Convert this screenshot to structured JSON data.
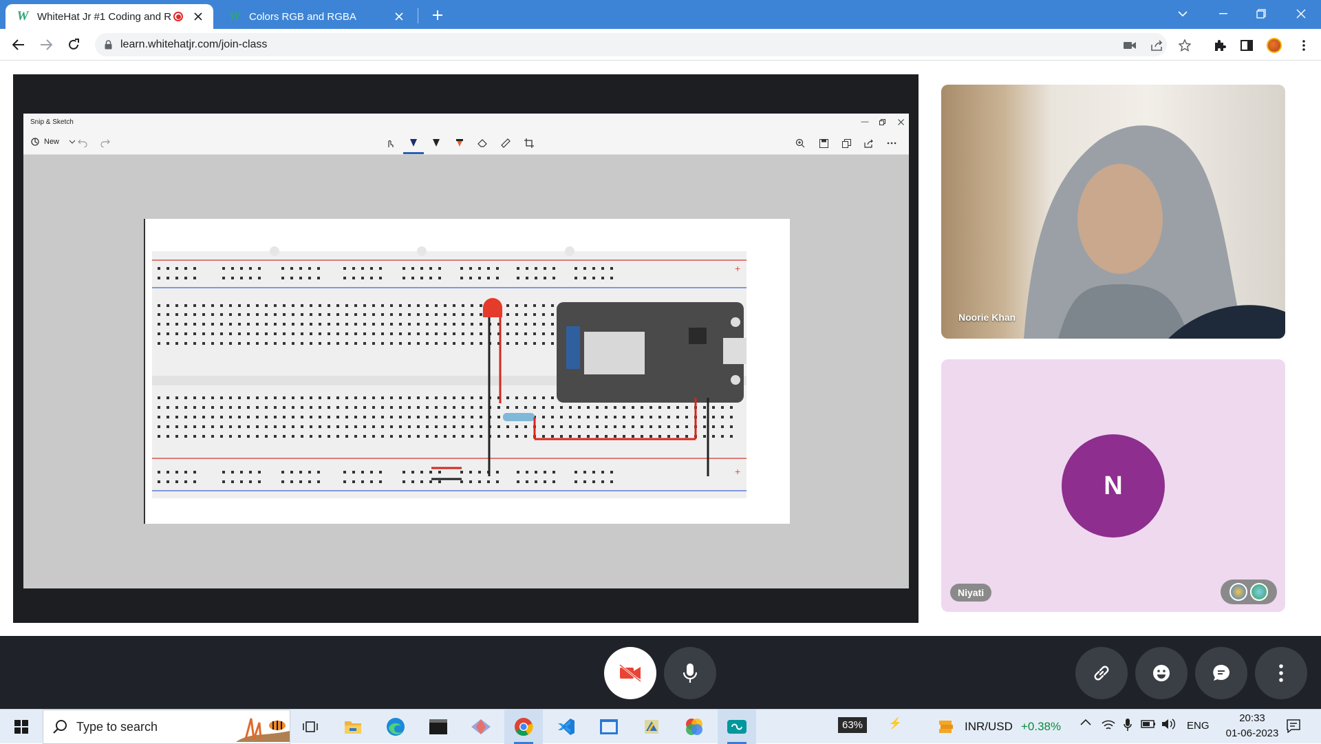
{
  "browser": {
    "tabs": [
      {
        "title": "WhiteHat Jr #1 Coding and R",
        "favicon": "W",
        "recording": true,
        "active": true
      },
      {
        "title": "Colors RGB and RGBA",
        "favicon": "W",
        "active": false
      }
    ],
    "url": "learn.whitehatjr.com/join-class"
  },
  "shared_screen": {
    "app_title": "Snip & Sketch",
    "new_label": "New"
  },
  "participants": [
    {
      "name": "Noorie Khan",
      "type": "video"
    },
    {
      "name": "Niyati",
      "type": "avatar",
      "initial": "N",
      "avatar_color": "#8e2e8e"
    }
  ],
  "controls": [
    "camera-off",
    "microphone",
    "link",
    "emoji",
    "chat",
    "more"
  ],
  "taskbar": {
    "search_placeholder": "Type to search",
    "battery": "63%",
    "ticker": {
      "symbol": "INR/USD",
      "change": "+0.38%"
    },
    "language": "ENG",
    "time": "20:33",
    "date": "01-06-2023"
  },
  "colors": {
    "chrome_blue": "#3d84d6",
    "camera_off_red": "#ea4335",
    "avatar_purple": "#8e2e8e",
    "ticker_green": "#0a8a3a"
  }
}
